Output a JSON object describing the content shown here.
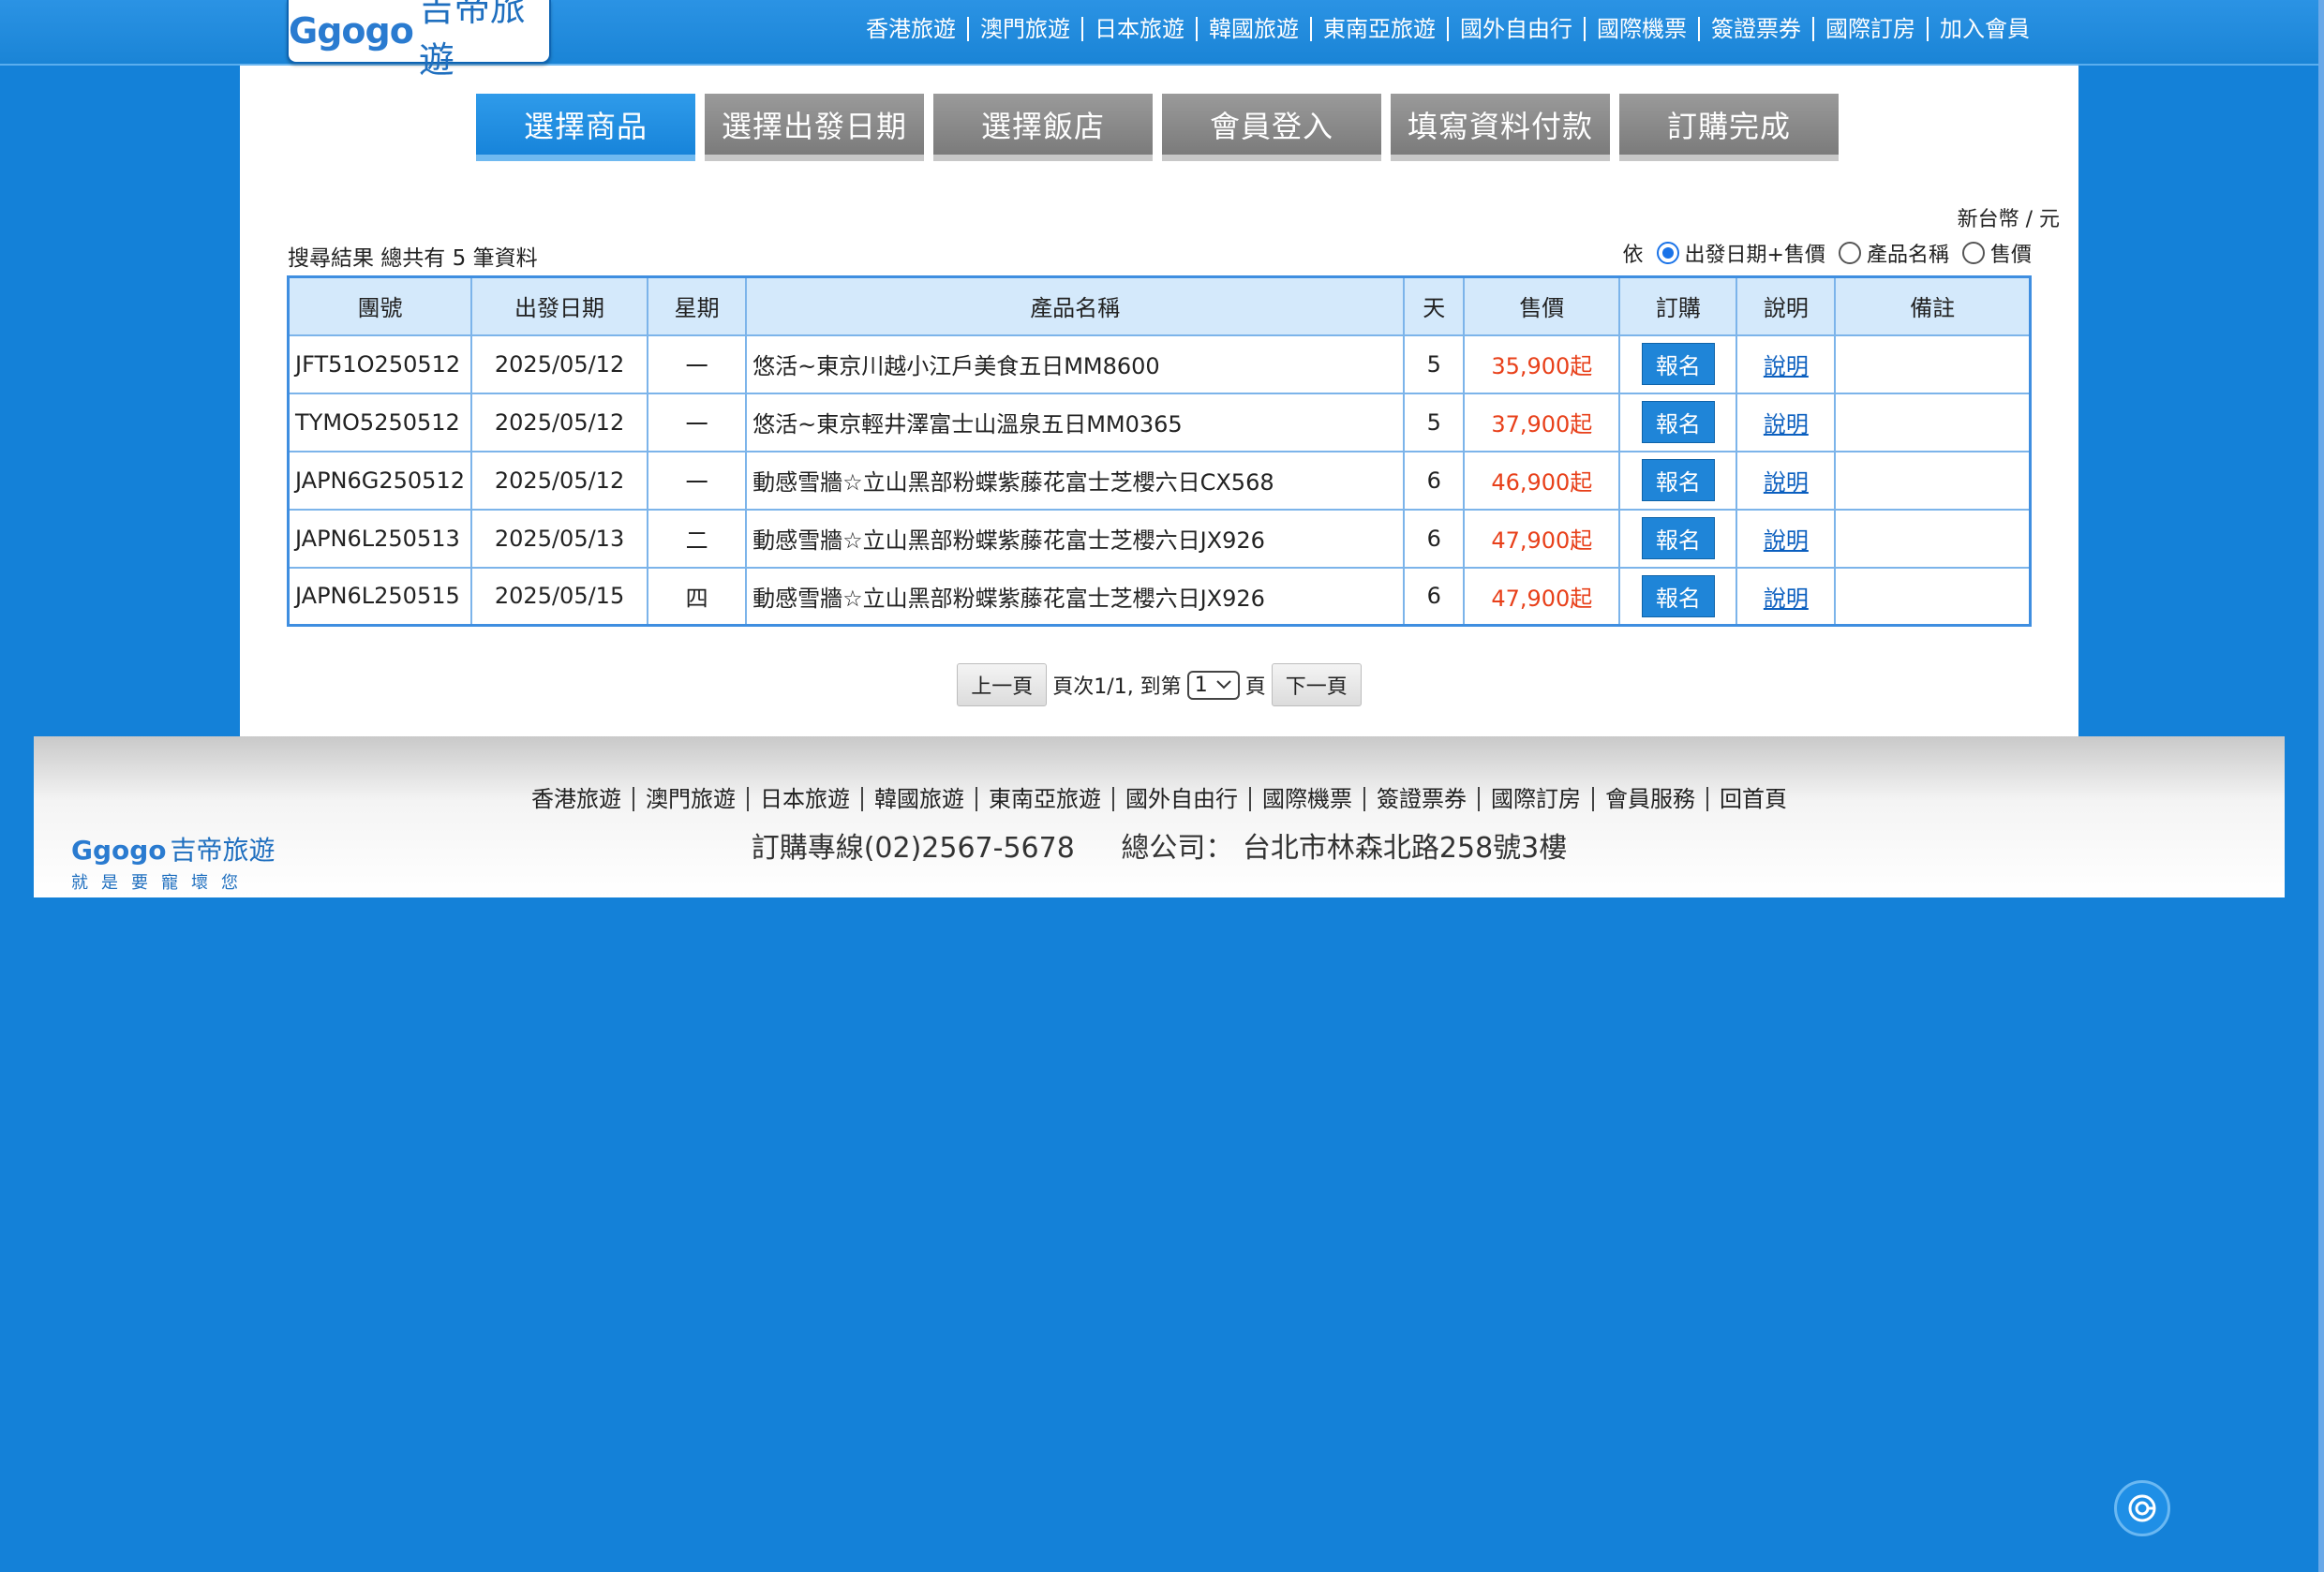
{
  "header": {
    "logo_en": "Ggogo",
    "logo_cn": "吉帝旅遊",
    "nav": [
      "香港旅遊",
      "澳門旅遊",
      "日本旅遊",
      "韓國旅遊",
      "東南亞旅遊",
      "國外自由行",
      "國際機票",
      "簽證票券",
      "國際訂房",
      "加入會員"
    ]
  },
  "steps": [
    "選擇商品",
    "選擇出發日期",
    "選擇飯店",
    "會員登入",
    "填寫資料付款",
    "訂購完成"
  ],
  "active_step": "選擇商品",
  "currency": "新台幣 / 元",
  "result_count": "搜尋結果 總共有 5 筆資料",
  "sort": {
    "label": "依",
    "options": [
      "出發日期+售價",
      "產品名稱",
      "售價"
    ],
    "selected": "出發日期+售價"
  },
  "table": {
    "headers": [
      "團號",
      "出發日期",
      "星期",
      "產品名稱",
      "天",
      "售價",
      "訂購",
      "說明",
      "備註"
    ],
    "rows": [
      {
        "code": "JFT51O250512",
        "date": "2025/05/12",
        "weekday": "一",
        "name": "悠活~東京川越小江戶美食五日MM8600",
        "days": "5",
        "price": "35,900起",
        "book": "報名",
        "info": "說明",
        "note": ""
      },
      {
        "code": "TYMO5250512",
        "date": "2025/05/12",
        "weekday": "一",
        "name": "悠活~東京輕井澤富士山溫泉五日MM0365",
        "days": "5",
        "price": "37,900起",
        "book": "報名",
        "info": "說明",
        "note": ""
      },
      {
        "code": "JAPN6G250512",
        "date": "2025/05/12",
        "weekday": "一",
        "name": "動感雪牆☆立山黑部粉蝶紫藤花富士芝櫻六日CX568",
        "days": "6",
        "price": "46,900起",
        "book": "報名",
        "info": "說明",
        "note": ""
      },
      {
        "code": "JAPN6L250513",
        "date": "2025/05/13",
        "weekday": "二",
        "name": "動感雪牆☆立山黑部粉蝶紫藤花富士芝櫻六日JX926",
        "days": "6",
        "price": "47,900起",
        "book": "報名",
        "info": "說明",
        "note": ""
      },
      {
        "code": "JAPN6L250515",
        "date": "2025/05/15",
        "weekday": "四",
        "name": "動感雪牆☆立山黑部粉蝶紫藤花富士芝櫻六日JX926",
        "days": "6",
        "price": "47,900起",
        "book": "報名",
        "info": "說明",
        "note": ""
      }
    ]
  },
  "pagination": {
    "prev": "上一頁",
    "page_info": "頁次1/1, 到第",
    "page_value": "1",
    "page_suffix": "頁",
    "next": "下一頁"
  },
  "footer": {
    "logo_en": "Ggogo",
    "logo_cn": "吉帝旅遊",
    "slogan": "就是要寵壞您",
    "nav": [
      "香港旅遊",
      "澳門旅遊",
      "日本旅遊",
      "韓國旅遊",
      "東南亞旅遊",
      "國外自由行",
      "國際機票",
      "簽證票券",
      "國際訂房",
      "會員服務",
      "回首頁"
    ],
    "hotline": "訂購專線(02)2567-5678",
    "address": "總公司： 台北市林森北路258號3樓"
  },
  "colors": {
    "background": "#1481d8",
    "accent": "#1f85d8",
    "price": "#e8401a"
  },
  "icons": {
    "chat_widget": "chat-bubble-icon"
  }
}
